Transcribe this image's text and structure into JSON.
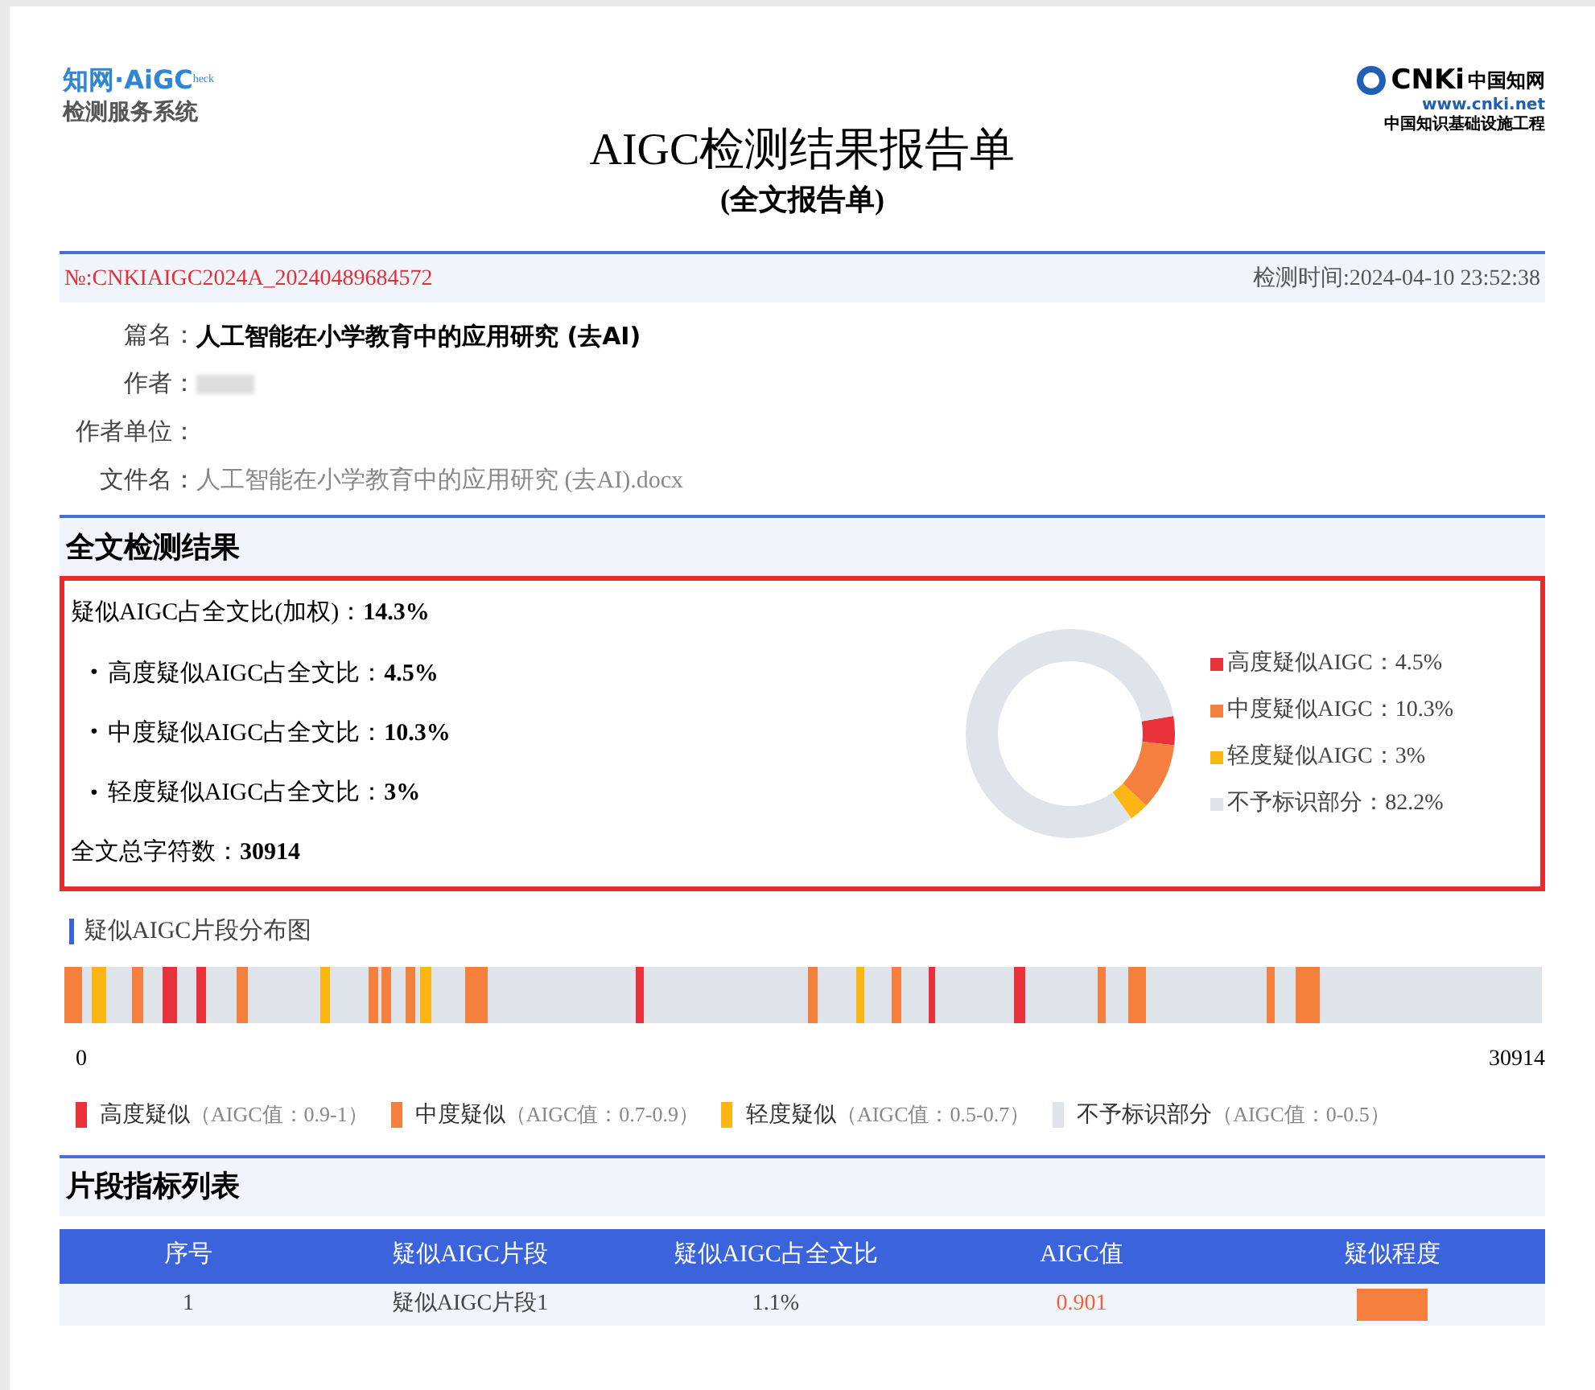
{
  "header": {
    "logo_left": {
      "brand": "知网·AiGC",
      "badge": "heck",
      "subtitle": "检测服务系统"
    },
    "logo_right": {
      "brand": "CNKi",
      "name": "中国知网",
      "url": "www.cnki.net",
      "tagline": "中国知识基础设施工程"
    },
    "title": "AIGC检测结果报告单",
    "subtitle": "(全文报告单)"
  },
  "report": {
    "number": "№:CNKIAIGC2024A_20240489684572",
    "time": "检测时间:2024-04-10 23:52:38",
    "fields": [
      {
        "label": "篇名：",
        "value": "人工智能在小学教育中的应用研究 (去AI)",
        "kind": "bold"
      },
      {
        "label": "作者：",
        "kind": "redacted"
      },
      {
        "label": "作者单位：",
        "kind": "empty"
      },
      {
        "label": "文件名：",
        "value": "人工智能在小学教育中的应用研究 (去AI).docx",
        "kind": "muted"
      }
    ]
  },
  "overall": {
    "title": "全文检测结果",
    "highlighted": true,
    "weighted": {
      "label": "疑似AIGC占全文比(加权)：",
      "value": "14.3%"
    },
    "breakdown": [
      {
        "bullet": "•",
        "label": "高度疑似AIGC占全文比：",
        "value": "4.5%"
      },
      {
        "bullet": "•",
        "label": "中度疑似AIGC占全文比：",
        "value": "10.3%"
      },
      {
        "bullet": "•",
        "label": "轻度疑似AIGC占全文比：",
        "value": "3%"
      }
    ],
    "total": {
      "label": "全文总字符数：",
      "value": "30914"
    },
    "chart_data": {
      "type": "donut",
      "categories": [
        "高度疑似AIGC",
        "中度疑似AIGC",
        "轻度疑似AIGC",
        "不予标识部分"
      ],
      "values": [
        4.5,
        10.3,
        3,
        82.2
      ]
    },
    "legend": [
      {
        "sep": "：",
        "value": "4.5%",
        "color": "#e8313a"
      },
      {
        "sep": "：",
        "value": "10.3%",
        "color": "#f5803e"
      },
      {
        "sep": "：",
        "value": "3%",
        "color": "#fbb614"
      },
      {
        "sep": "：",
        "value": "82.2%",
        "color": "#dfe3ea"
      }
    ]
  },
  "distribution": {
    "title": "疑似AIGC片段分布图",
    "start": "0",
    "end": "30914",
    "legend": [
      {
        "label": "高度疑似",
        "note": "（AIGC值：0.9-1）",
        "color": "#e8313a"
      },
      {
        "label": "中度疑似",
        "note": "（AIGC值：0.7-0.9）",
        "color": "#f5803e"
      },
      {
        "label": "轻度疑似",
        "note": "（AIGC值：0.5-0.7）",
        "color": "#fbb614"
      },
      {
        "label": "不予标识部分",
        "note": "（AIGC值：0-0.5）",
        "color": "#dfe3ea"
      }
    ]
  },
  "segments": {
    "title": "片段指标列表",
    "columns": [
      "序号",
      "疑似AIGC片段",
      "疑似AIGC占全文比",
      "AIGC值",
      "疑似程度"
    ],
    "rows": [
      {
        "cells": [
          "1",
          "疑似AIGC片段1",
          "1.1%",
          "0.901"
        ],
        "color": "#f5803e"
      }
    ]
  }
}
